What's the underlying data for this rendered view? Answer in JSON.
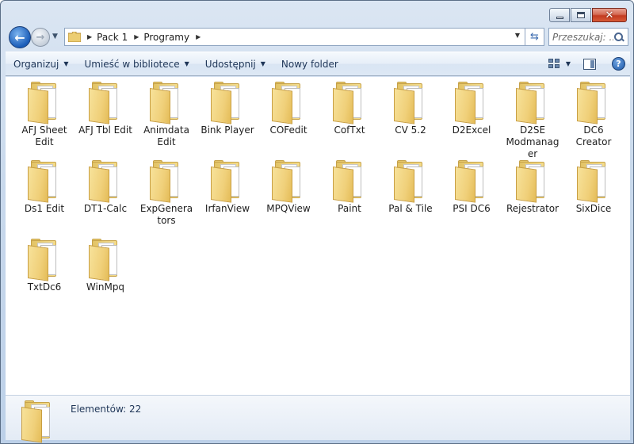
{
  "window": {
    "caption": {
      "min_label": "",
      "max_label": "",
      "close_label": "✕"
    }
  },
  "nav": {
    "breadcrumbs": [
      "Pack 1",
      "Programy"
    ],
    "search_placeholder": "Przeszukaj: ..."
  },
  "toolbar": {
    "organize": "Organizuj",
    "include_library": "Umieść w bibliotece",
    "share": "Udostępnij",
    "new_folder": "Nowy folder"
  },
  "items": [
    {
      "label": "AFJ Sheet Edit"
    },
    {
      "label": "AFJ Tbl Edit"
    },
    {
      "label": "Animdata Edit"
    },
    {
      "label": "Bink Player"
    },
    {
      "label": "COFedit"
    },
    {
      "label": "CofTxt"
    },
    {
      "label": "CV 5.2"
    },
    {
      "label": "D2Excel"
    },
    {
      "label": "D2SE Modmanager"
    },
    {
      "label": "DC6 Creator"
    },
    {
      "label": "Ds1 Edit"
    },
    {
      "label": "DT1-Calc"
    },
    {
      "label": "ExpGenerators"
    },
    {
      "label": "IrfanView"
    },
    {
      "label": "MPQView"
    },
    {
      "label": "Paint"
    },
    {
      "label": "Pal & Tile"
    },
    {
      "label": "PSI DC6"
    },
    {
      "label": "Rejestrator"
    },
    {
      "label": "SixDice"
    },
    {
      "label": "TxtDc6"
    },
    {
      "label": "WinMpq"
    }
  ],
  "details": {
    "count_text": "Elementów: 22"
  },
  "colors": {
    "accent": "#1a5cb8",
    "close_button": "#c23b20",
    "folder": "#f0d07a"
  }
}
